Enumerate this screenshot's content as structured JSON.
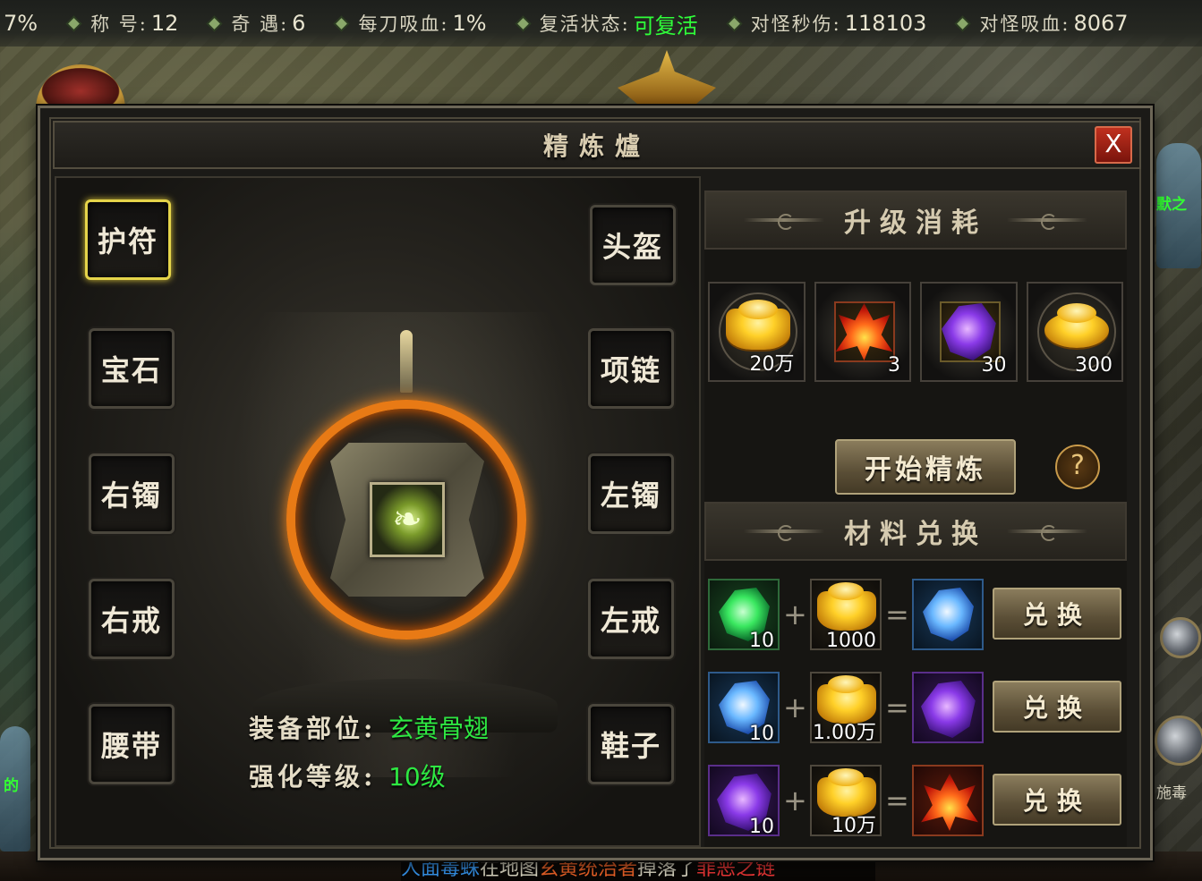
{
  "topbar": {
    "stats": [
      {
        "label": "",
        "value": "7%",
        "green": false
      },
      {
        "label": "称 号:",
        "value": "12",
        "green": false
      },
      {
        "label": "奇 遇:",
        "value": "6",
        "green": false
      },
      {
        "label": "每刀吸血:",
        "value": "1%",
        "green": false
      },
      {
        "label": "复活状态:",
        "value": "可复活",
        "green": true
      },
      {
        "label": "对怪秒伤:",
        "value": "118103",
        "green": false
      },
      {
        "label": "对怪吸血:",
        "value": "8067",
        "green": false
      }
    ]
  },
  "dialog": {
    "title": "精炼爐",
    "close_label": "X",
    "slots_left": [
      "护符",
      "宝石",
      "右镯",
      "右戒",
      "腰带"
    ],
    "slots_right": [
      "头盔",
      "项链",
      "左镯",
      "左戒",
      "鞋子"
    ],
    "selected_slot": "护符",
    "equip_part_label": "装备部位:",
    "equip_part_value": "玄黄骨翅",
    "enhance_level_label": "强化等级:",
    "enhance_level_value": "10级"
  },
  "upgrade_cost": {
    "title": "升级消耗",
    "items": [
      {
        "icon": "gold-ingot",
        "qty": "20万"
      },
      {
        "icon": "red-crystal",
        "qty": "3"
      },
      {
        "icon": "purple-crystal",
        "qty": "30"
      },
      {
        "icon": "gold-coins",
        "qty": "300"
      }
    ],
    "start_button": "开始精炼",
    "help_label": "?"
  },
  "exchange": {
    "title": "材料兑换",
    "rows": [
      {
        "input_icon": "green-crystal",
        "input_qty": "10",
        "gold_qty": "1000",
        "output_icon": "blue-crystal",
        "button": "兑换"
      },
      {
        "input_icon": "blue-crystal",
        "input_qty": "10",
        "gold_qty": "1.00万",
        "output_icon": "purple-crystal",
        "button": "兑换"
      },
      {
        "input_icon": "purple-crystal",
        "input_qty": "10",
        "gold_qty": "10万",
        "output_icon": "red-crystal",
        "button": "兑换"
      }
    ],
    "plus": "+",
    "equals": "="
  },
  "side": {
    "npc_tag_right": "默之",
    "npc_tag_left": "的",
    "orb_label": "施毒"
  },
  "chat": {
    "seg1": "人面毒蛛",
    "seg2": "在地图",
    "seg3": "玄黄统治者",
    "seg4": "掉落了",
    "seg5": "罪恶之链"
  },
  "colors": {
    "accent_gold": "#e5d44a",
    "value_green": "#2ee842",
    "status_green": "#2fff3a",
    "ring_orange": "#e87a15"
  }
}
